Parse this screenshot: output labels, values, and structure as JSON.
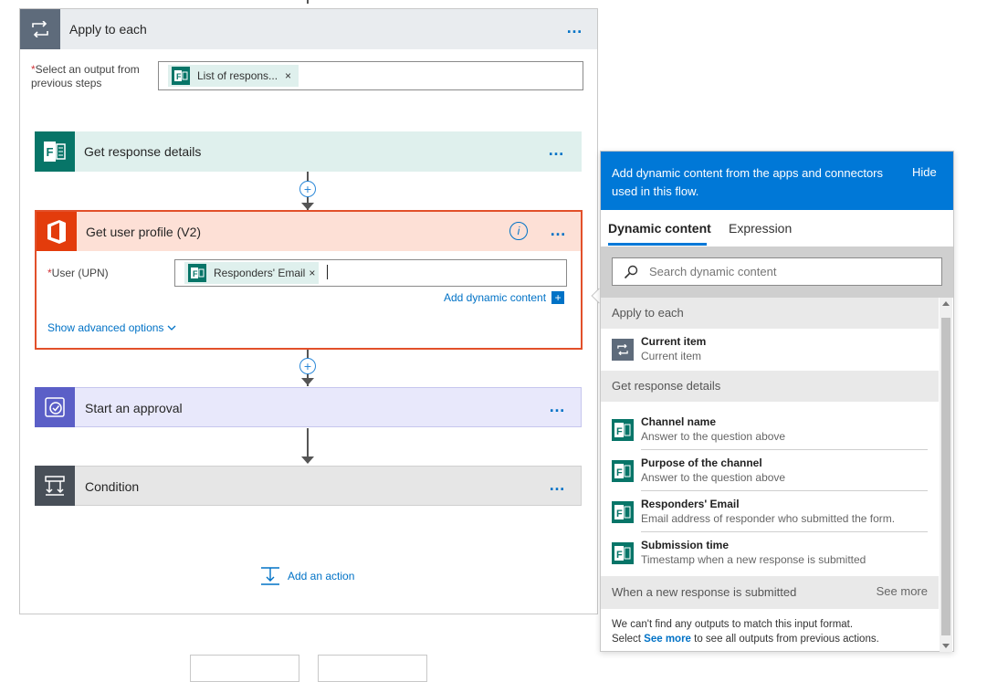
{
  "apply_each": {
    "title": "Apply to each",
    "select_label": "Select an output from previous steps",
    "required_mark": "*",
    "token": "List of respons..."
  },
  "steps": {
    "get_response": "Get response details",
    "get_profile": "Get user profile (V2)",
    "start_approval": "Start an approval",
    "condition": "Condition"
  },
  "profile": {
    "upn_label": "User (UPN)",
    "required_mark": "*",
    "token": "Responders' Email",
    "add_dynamic": "Add dynamic content",
    "show_advanced": "Show advanced options"
  },
  "more_label": "…",
  "token_remove": "×",
  "add_action": "Add an action",
  "panel": {
    "header": "Add dynamic content from the apps and connectors used in this flow.",
    "hide": "Hide",
    "tabs": [
      "Dynamic content",
      "Expression"
    ],
    "search_placeholder": "Search dynamic content",
    "sections": [
      {
        "label": "Apply to each"
      },
      {
        "label": "Get response details"
      },
      {
        "label": "When a new response is submitted",
        "see_more": "See more"
      }
    ],
    "items": [
      {
        "title": "Current item",
        "subtitle": "Current item",
        "icon": "loop-icon"
      },
      {
        "title": "Channel name",
        "subtitle": "Answer to the question above",
        "icon": "forms-icon"
      },
      {
        "title": "Purpose of the channel",
        "subtitle": "Answer to the question above",
        "icon": "forms-icon"
      },
      {
        "title": "Responders' Email",
        "subtitle": "Email address of responder who submitted the form.",
        "icon": "forms-icon"
      },
      {
        "title": "Submission time",
        "subtitle": "Timestamp when a new response is submitted",
        "icon": "forms-icon"
      }
    ],
    "no_outputs_1": "We can't find any outputs to match this input format.",
    "no_outputs_2a": "Select ",
    "no_outputs_link": "See more",
    "no_outputs_2b": " to see all outputs from previous actions."
  },
  "colors": {
    "accent": "#0078d7",
    "forms": "#077568",
    "office": "#e33c0c",
    "approval": "#5b5fc7",
    "condition": "#484f58",
    "loop": "#5e6b7b"
  }
}
